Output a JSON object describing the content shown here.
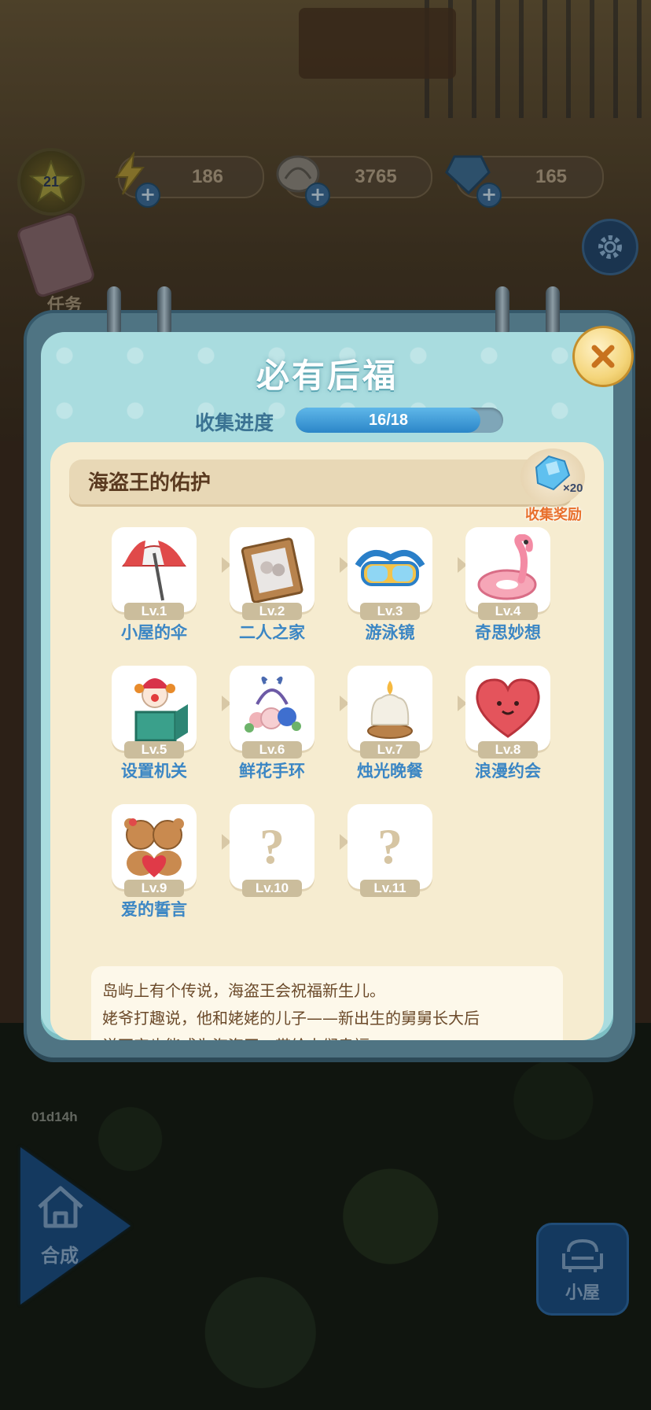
{
  "hud": {
    "level": "21",
    "energy": "186",
    "coins": "3765",
    "gems": "165",
    "task_label": "任务",
    "event_timer": "01d14h"
  },
  "nav": {
    "merge_label": "合成",
    "house_label": "小屋"
  },
  "modal": {
    "title": "必有后福",
    "progress_label": "收集进度",
    "progress_text": "16/18",
    "progress_fraction": 0.889,
    "section_title": "海盗王的佑护",
    "reward_multiplier": "×20",
    "reward_label": "收集奖励",
    "items": [
      {
        "lv": "Lv.1",
        "name": "小屋的伞",
        "icon": "beach-umbrella-icon"
      },
      {
        "lv": "Lv.2",
        "name": "二人之家",
        "icon": "photo-frame-icon"
      },
      {
        "lv": "Lv.3",
        "name": "游泳镜",
        "icon": "swim-goggles-icon"
      },
      {
        "lv": "Lv.4",
        "name": "奇思妙想",
        "icon": "flamingo-float-icon"
      },
      {
        "lv": "Lv.5",
        "name": "设置机关",
        "icon": "jack-in-the-box-icon"
      },
      {
        "lv": "Lv.6",
        "name": "鲜花手环",
        "icon": "flower-bracelet-icon"
      },
      {
        "lv": "Lv.7",
        "name": "烛光晚餐",
        "icon": "candle-icon"
      },
      {
        "lv": "Lv.8",
        "name": "浪漫约会",
        "icon": "heart-pillow-icon"
      },
      {
        "lv": "Lv.9",
        "name": "爱的誓言",
        "icon": "teddy-bears-icon"
      },
      {
        "lv": "Lv.10",
        "name": "",
        "icon": "question-mark-icon"
      },
      {
        "lv": "Lv.11",
        "name": "",
        "icon": "question-mark-icon"
      }
    ],
    "locked_symbol": "?",
    "description": [
      "岛屿上有个传说，海盗王会祝福新生儿。",
      "姥爷打趣说，他和姥姥的儿子——新出生的舅舅长大后",
      "说不定也能成为海盗王，带给人们幸福。"
    ]
  },
  "colors": {
    "modal_bg": "#a9dcdf",
    "content_bg": "#f6ecd0",
    "item_name": "#3b86c4",
    "progress_fill": "#2b86c8",
    "reward_label": "#e86f2b"
  }
}
